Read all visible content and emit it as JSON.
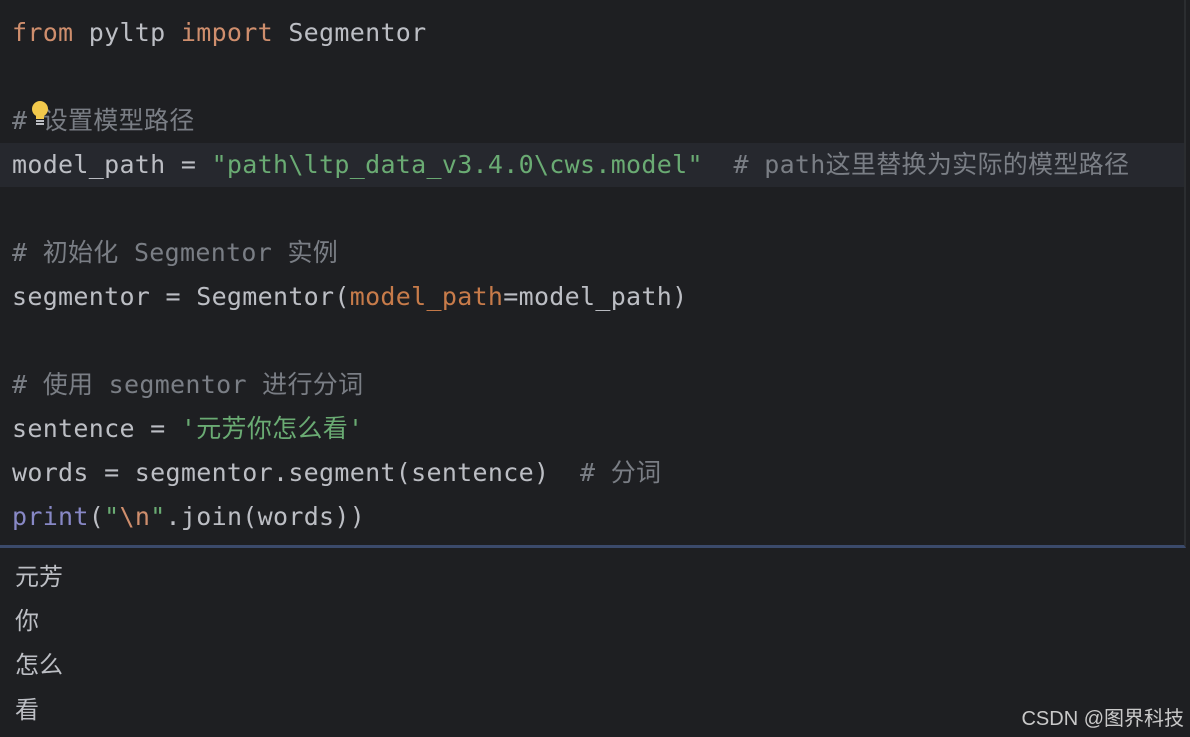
{
  "editor": {
    "lines": [
      [
        {
          "t": "from",
          "c": "kw"
        },
        {
          "t": " pyltp ",
          "c": ""
        },
        {
          "t": "import",
          "c": "kw"
        },
        {
          "t": " Segmentor",
          "c": ""
        }
      ],
      [],
      [
        {
          "t": "# 设置模型路径",
          "c": "cm"
        }
      ],
      [
        {
          "t": "model_path = ",
          "c": ""
        },
        {
          "t": "\"path\\ltp_data_v3.4.0\\cws.model\"",
          "c": "str"
        },
        {
          "t": "  # path这里替换为实际的模型路径",
          "c": "cm"
        }
      ],
      [],
      [
        {
          "t": "# 初始化 Segmentor 实例",
          "c": "cm"
        }
      ],
      [
        {
          "t": "segmentor = Segmentor(",
          "c": ""
        },
        {
          "t": "model_path",
          "c": "param"
        },
        {
          "t": "=model_path)",
          "c": ""
        }
      ],
      [],
      [
        {
          "t": "# 使用 segmentor 进行分词",
          "c": "cm"
        }
      ],
      [
        {
          "t": "sentence = ",
          "c": ""
        },
        {
          "t": "'元芳你怎么看'",
          "c": "str"
        }
      ],
      [
        {
          "t": "words = segmentor.segment(sentence)  ",
          "c": ""
        },
        {
          "t": "# 分词",
          "c": "cm"
        }
      ],
      [
        {
          "t": "print",
          "c": "builtin"
        },
        {
          "t": "(",
          "c": ""
        },
        {
          "t": "\"",
          "c": "str"
        },
        {
          "t": "\\n",
          "c": "esc"
        },
        {
          "t": "\"",
          "c": "str"
        },
        {
          "t": ".join(words))",
          "c": ""
        }
      ]
    ],
    "highlighted_line": 4,
    "intention_icon": "lightbulb-icon"
  },
  "output": {
    "lines": [
      "元芳",
      "你",
      "怎么",
      "看"
    ]
  },
  "watermark": "CSDN @图界科技",
  "colors": {
    "background": "#1e1f22",
    "keyword": "#cf8e6d",
    "string": "#6aab73",
    "comment": "#7a7e85",
    "parameter": "#c77b4a",
    "builtin": "#8888c6",
    "text": "#bcbec4",
    "bulb": "#f2c94c"
  }
}
